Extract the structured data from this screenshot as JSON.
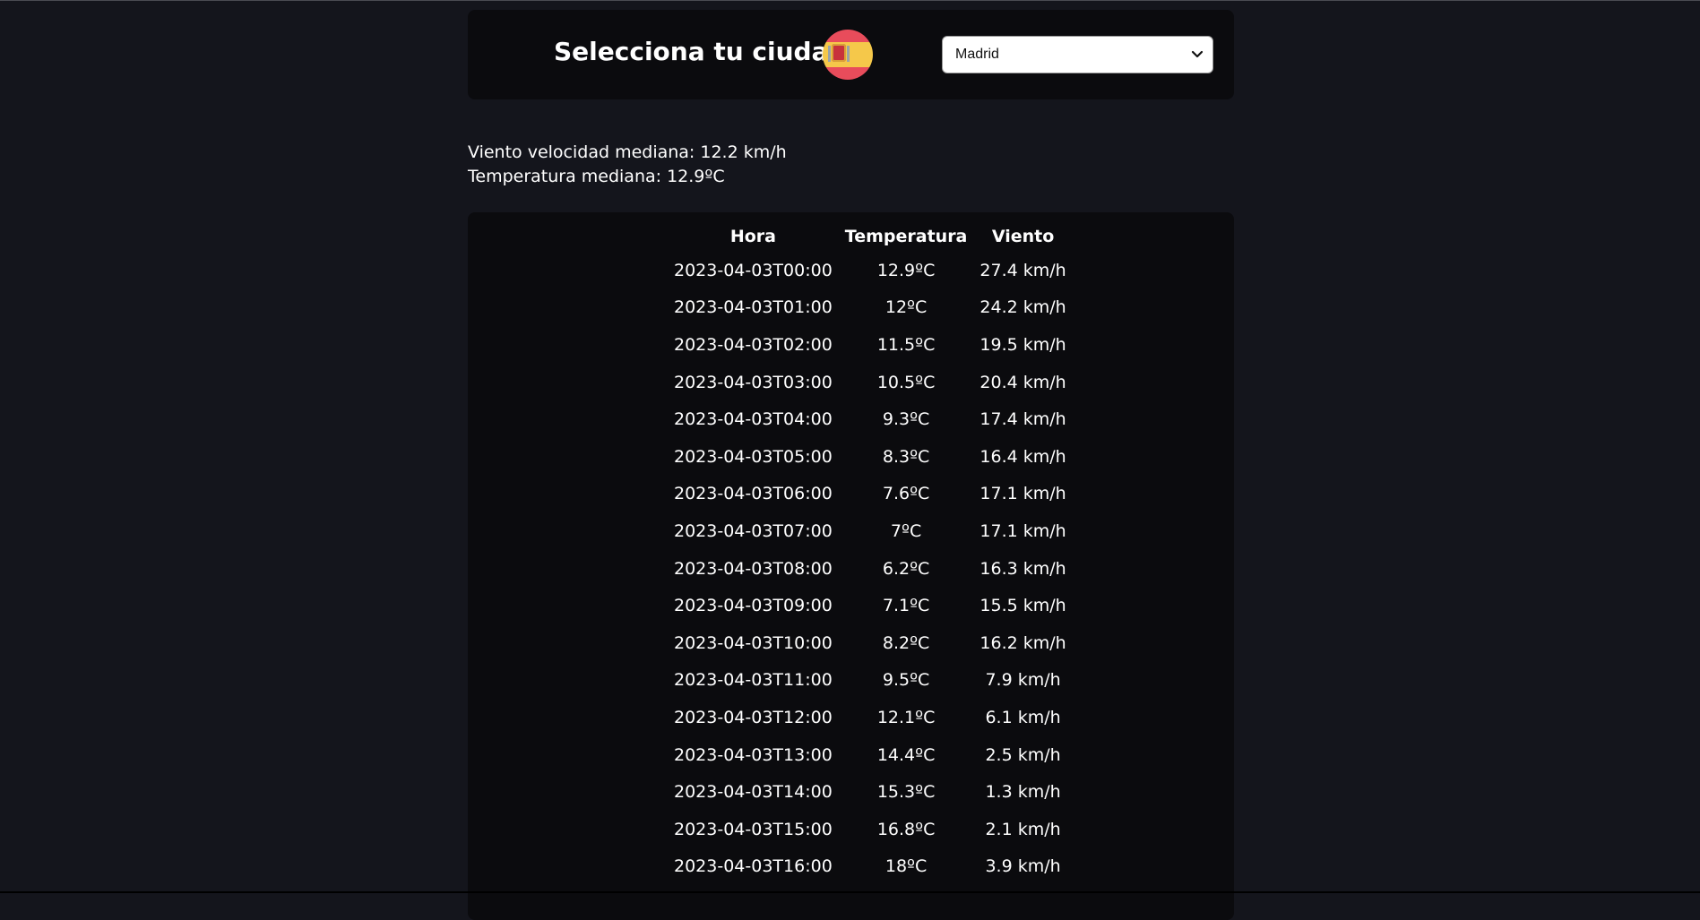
{
  "header": {
    "title": "Selecciona tu ciudad",
    "flag_icon": "spain-flag-icon",
    "city_select": {
      "selected": "Madrid"
    }
  },
  "stats": {
    "wind_median": "Viento velocidad mediana: 12.2 km/h",
    "temp_median": "Temperatura mediana: 12.9ºC"
  },
  "table": {
    "columns": [
      "Hora",
      "Temperatura",
      "Viento"
    ],
    "rows": [
      [
        "2023-04-03T00:00",
        "12.9ºC",
        "27.4 km/h"
      ],
      [
        "2023-04-03T01:00",
        "12ºC",
        "24.2 km/h"
      ],
      [
        "2023-04-03T02:00",
        "11.5ºC",
        "19.5 km/h"
      ],
      [
        "2023-04-03T03:00",
        "10.5ºC",
        "20.4 km/h"
      ],
      [
        "2023-04-03T04:00",
        "9.3ºC",
        "17.4 km/h"
      ],
      [
        "2023-04-03T05:00",
        "8.3ºC",
        "16.4 km/h"
      ],
      [
        "2023-04-03T06:00",
        "7.6ºC",
        "17.1 km/h"
      ],
      [
        "2023-04-03T07:00",
        "7ºC",
        "17.1 km/h"
      ],
      [
        "2023-04-03T08:00",
        "6.2ºC",
        "16.3 km/h"
      ],
      [
        "2023-04-03T09:00",
        "7.1ºC",
        "15.5 km/h"
      ],
      [
        "2023-04-03T10:00",
        "8.2ºC",
        "16.2 km/h"
      ],
      [
        "2023-04-03T11:00",
        "9.5ºC",
        "7.9 km/h"
      ],
      [
        "2023-04-03T12:00",
        "12.1ºC",
        "6.1 km/h"
      ],
      [
        "2023-04-03T13:00",
        "14.4ºC",
        "2.5 km/h"
      ],
      [
        "2023-04-03T14:00",
        "15.3ºC",
        "1.3 km/h"
      ],
      [
        "2023-04-03T15:00",
        "16.8ºC",
        "2.1 km/h"
      ],
      [
        "2023-04-03T16:00",
        "18ºC",
        "3.9 km/h"
      ]
    ]
  },
  "colors": {
    "page_background": "#14151c",
    "panel_background": "#0b0b0e",
    "text": "#ffffff"
  }
}
